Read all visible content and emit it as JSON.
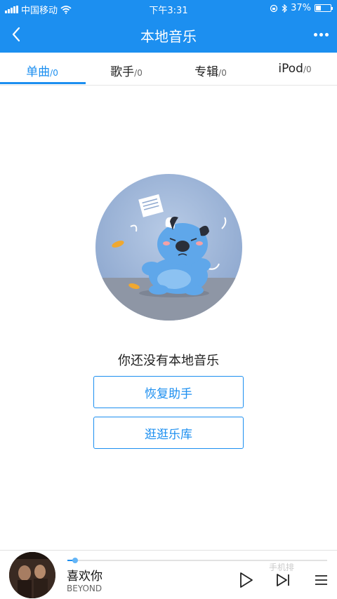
{
  "status_bar": {
    "carrier": "中国移动",
    "time": "下午3:31",
    "battery_text": "37%",
    "battery_level": 0.37
  },
  "header": {
    "title": "本地音乐"
  },
  "tabs": [
    {
      "name": "单曲",
      "count": "/0"
    },
    {
      "name": "歌手",
      "count": "/0"
    },
    {
      "name": "专辑",
      "count": "/0"
    },
    {
      "name": "iPod",
      "count": "/0"
    }
  ],
  "empty_state": {
    "message": "你还没有本地音乐",
    "restore_button": "恢复助手",
    "browse_button": "逛逛乐库"
  },
  "player": {
    "title": "喜欢你",
    "artist": "BEYOND",
    "progress": 0.03
  },
  "watermark": "手机排",
  "colors": {
    "accent": "#1c8ff0"
  }
}
